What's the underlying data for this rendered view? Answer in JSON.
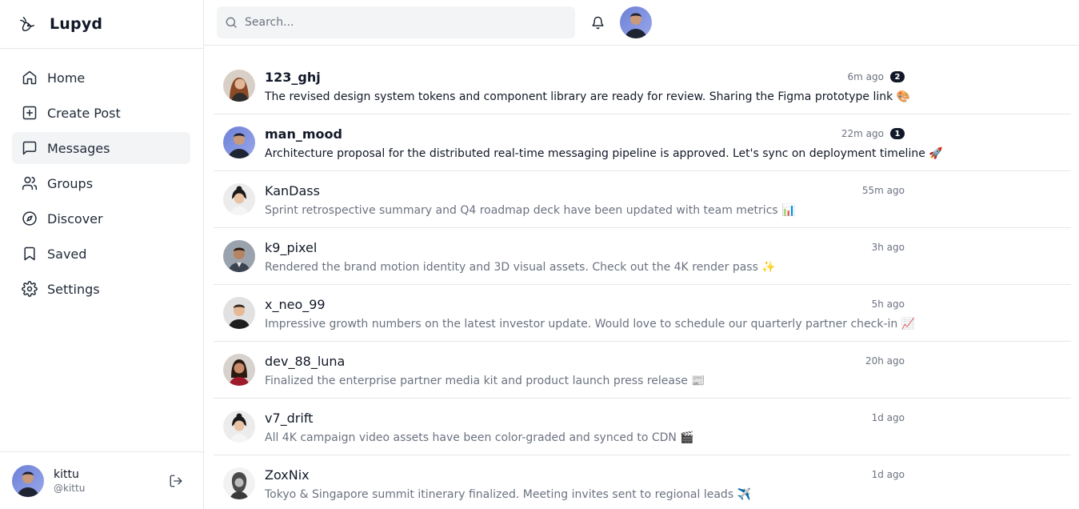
{
  "brand": {
    "name": "Lupyd"
  },
  "nav": {
    "items": [
      {
        "label": "Home",
        "icon": "home-icon"
      },
      {
        "label": "Create Post",
        "icon": "plus-square-icon"
      },
      {
        "label": "Messages",
        "icon": "message-square-icon",
        "active": true
      },
      {
        "label": "Groups",
        "icon": "users-icon"
      },
      {
        "label": "Discover",
        "icon": "compass-icon"
      },
      {
        "label": "Saved",
        "icon": "bookmark-icon"
      },
      {
        "label": "Settings",
        "icon": "gear-icon"
      }
    ]
  },
  "search": {
    "placeholder": "Search..."
  },
  "user": {
    "name": "kittu",
    "handle": "@kittu"
  },
  "messages": [
    {
      "user": "123_ghj",
      "preview": "The revised design system tokens and component library are ready for review. Sharing the Figma prototype link 🎨",
      "time": "6m ago",
      "unread": "2"
    },
    {
      "user": "man_mood",
      "preview": "Architecture proposal for the distributed real-time messaging pipeline is approved. Let's sync on deployment timeline 🚀",
      "time": "22m ago",
      "unread": "1"
    },
    {
      "user": "KanDass",
      "preview": "Sprint retrospective summary and Q4 roadmap deck have been updated with team metrics 📊",
      "time": "55m ago"
    },
    {
      "user": "k9_pixel",
      "preview": "Rendered the brand motion identity and 3D visual assets. Check out the 4K render pass ✨",
      "time": "3h ago"
    },
    {
      "user": "x_neo_99",
      "preview": "Impressive growth numbers on the latest investor update. Would love to schedule our quarterly partner check-in 📈",
      "time": "5h ago"
    },
    {
      "user": "dev_88_luna",
      "preview": "Finalized the enterprise partner media kit and product launch press release 📰",
      "time": "20h ago"
    },
    {
      "user": "v7_drift",
      "preview": "All 4K campaign video assets have been color-graded and synced to CDN 🎬",
      "time": "1d ago"
    },
    {
      "user": "ZoxNix",
      "preview": "Tokyo & Singapore summit itinerary finalized. Meeting invites sent to regional leads ✈️",
      "time": "1d ago"
    }
  ],
  "colors": {
    "accent": "#111827",
    "muted": "#6b7280",
    "active_bg": "#f3f4f6",
    "border": "#e5e7eb"
  }
}
